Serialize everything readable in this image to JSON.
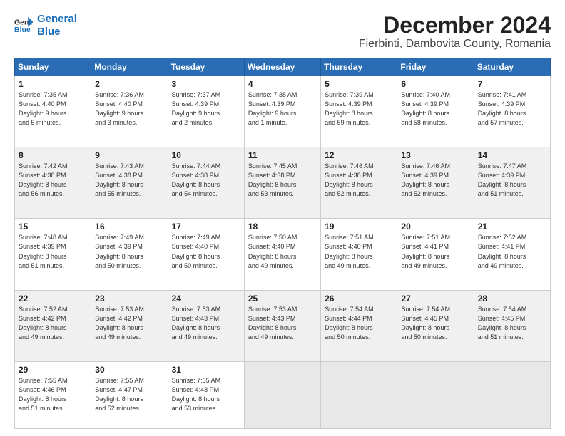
{
  "app": {
    "logo_line1": "General",
    "logo_line2": "Blue"
  },
  "header": {
    "title": "December 2024",
    "subtitle": "Fierbinti, Dambovita County, Romania"
  },
  "calendar": {
    "days_of_week": [
      "Sunday",
      "Monday",
      "Tuesday",
      "Wednesday",
      "Thursday",
      "Friday",
      "Saturday"
    ],
    "weeks": [
      [
        {
          "day": "1",
          "detail": "Sunrise: 7:35 AM\nSunset: 4:40 PM\nDaylight: 9 hours\nand 5 minutes."
        },
        {
          "day": "2",
          "detail": "Sunrise: 7:36 AM\nSunset: 4:40 PM\nDaylight: 9 hours\nand 3 minutes."
        },
        {
          "day": "3",
          "detail": "Sunrise: 7:37 AM\nSunset: 4:39 PM\nDaylight: 9 hours\nand 2 minutes."
        },
        {
          "day": "4",
          "detail": "Sunrise: 7:38 AM\nSunset: 4:39 PM\nDaylight: 9 hours\nand 1 minute."
        },
        {
          "day": "5",
          "detail": "Sunrise: 7:39 AM\nSunset: 4:39 PM\nDaylight: 8 hours\nand 59 minutes."
        },
        {
          "day": "6",
          "detail": "Sunrise: 7:40 AM\nSunset: 4:39 PM\nDaylight: 8 hours\nand 58 minutes."
        },
        {
          "day": "7",
          "detail": "Sunrise: 7:41 AM\nSunset: 4:39 PM\nDaylight: 8 hours\nand 57 minutes."
        }
      ],
      [
        {
          "day": "8",
          "detail": "Sunrise: 7:42 AM\nSunset: 4:38 PM\nDaylight: 8 hours\nand 56 minutes."
        },
        {
          "day": "9",
          "detail": "Sunrise: 7:43 AM\nSunset: 4:38 PM\nDaylight: 8 hours\nand 55 minutes."
        },
        {
          "day": "10",
          "detail": "Sunrise: 7:44 AM\nSunset: 4:38 PM\nDaylight: 8 hours\nand 54 minutes."
        },
        {
          "day": "11",
          "detail": "Sunrise: 7:45 AM\nSunset: 4:38 PM\nDaylight: 8 hours\nand 53 minutes."
        },
        {
          "day": "12",
          "detail": "Sunrise: 7:46 AM\nSunset: 4:38 PM\nDaylight: 8 hours\nand 52 minutes."
        },
        {
          "day": "13",
          "detail": "Sunrise: 7:46 AM\nSunset: 4:39 PM\nDaylight: 8 hours\nand 52 minutes."
        },
        {
          "day": "14",
          "detail": "Sunrise: 7:47 AM\nSunset: 4:39 PM\nDaylight: 8 hours\nand 51 minutes."
        }
      ],
      [
        {
          "day": "15",
          "detail": "Sunrise: 7:48 AM\nSunset: 4:39 PM\nDaylight: 8 hours\nand 51 minutes."
        },
        {
          "day": "16",
          "detail": "Sunrise: 7:49 AM\nSunset: 4:39 PM\nDaylight: 8 hours\nand 50 minutes."
        },
        {
          "day": "17",
          "detail": "Sunrise: 7:49 AM\nSunset: 4:40 PM\nDaylight: 8 hours\nand 50 minutes."
        },
        {
          "day": "18",
          "detail": "Sunrise: 7:50 AM\nSunset: 4:40 PM\nDaylight: 8 hours\nand 49 minutes."
        },
        {
          "day": "19",
          "detail": "Sunrise: 7:51 AM\nSunset: 4:40 PM\nDaylight: 8 hours\nand 49 minutes."
        },
        {
          "day": "20",
          "detail": "Sunrise: 7:51 AM\nSunset: 4:41 PM\nDaylight: 8 hours\nand 49 minutes."
        },
        {
          "day": "21",
          "detail": "Sunrise: 7:52 AM\nSunset: 4:41 PM\nDaylight: 8 hours\nand 49 minutes."
        }
      ],
      [
        {
          "day": "22",
          "detail": "Sunrise: 7:52 AM\nSunset: 4:42 PM\nDaylight: 8 hours\nand 49 minutes."
        },
        {
          "day": "23",
          "detail": "Sunrise: 7:53 AM\nSunset: 4:42 PM\nDaylight: 8 hours\nand 49 minutes."
        },
        {
          "day": "24",
          "detail": "Sunrise: 7:53 AM\nSunset: 4:43 PM\nDaylight: 8 hours\nand 49 minutes."
        },
        {
          "day": "25",
          "detail": "Sunrise: 7:53 AM\nSunset: 4:43 PM\nDaylight: 8 hours\nand 49 minutes."
        },
        {
          "day": "26",
          "detail": "Sunrise: 7:54 AM\nSunset: 4:44 PM\nDaylight: 8 hours\nand 50 minutes."
        },
        {
          "day": "27",
          "detail": "Sunrise: 7:54 AM\nSunset: 4:45 PM\nDaylight: 8 hours\nand 50 minutes."
        },
        {
          "day": "28",
          "detail": "Sunrise: 7:54 AM\nSunset: 4:45 PM\nDaylight: 8 hours\nand 51 minutes."
        }
      ],
      [
        {
          "day": "29",
          "detail": "Sunrise: 7:55 AM\nSunset: 4:46 PM\nDaylight: 8 hours\nand 51 minutes."
        },
        {
          "day": "30",
          "detail": "Sunrise: 7:55 AM\nSunset: 4:47 PM\nDaylight: 8 hours\nand 52 minutes."
        },
        {
          "day": "31",
          "detail": "Sunrise: 7:55 AM\nSunset: 4:48 PM\nDaylight: 8 hours\nand 53 minutes."
        },
        {
          "day": "",
          "detail": ""
        },
        {
          "day": "",
          "detail": ""
        },
        {
          "day": "",
          "detail": ""
        },
        {
          "day": "",
          "detail": ""
        }
      ]
    ]
  }
}
